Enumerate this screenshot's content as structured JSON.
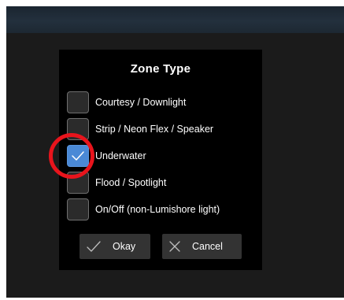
{
  "dialog": {
    "title": "Zone Type",
    "options": [
      {
        "label": "Courtesy / Downlight",
        "checked": false
      },
      {
        "label": "Strip / Neon Flex / Speaker",
        "checked": false
      },
      {
        "label": "Underwater",
        "checked": true
      },
      {
        "label": "Flood / Spotlight",
        "checked": false
      },
      {
        "label": "On/Off (non-Lumishore light)",
        "checked": false
      }
    ],
    "okay_label": "Okay",
    "cancel_label": "Cancel"
  },
  "colors": {
    "checked": "#4a89d6",
    "highlight_ring": "#e8141c",
    "dialog_bg": "#000000"
  }
}
